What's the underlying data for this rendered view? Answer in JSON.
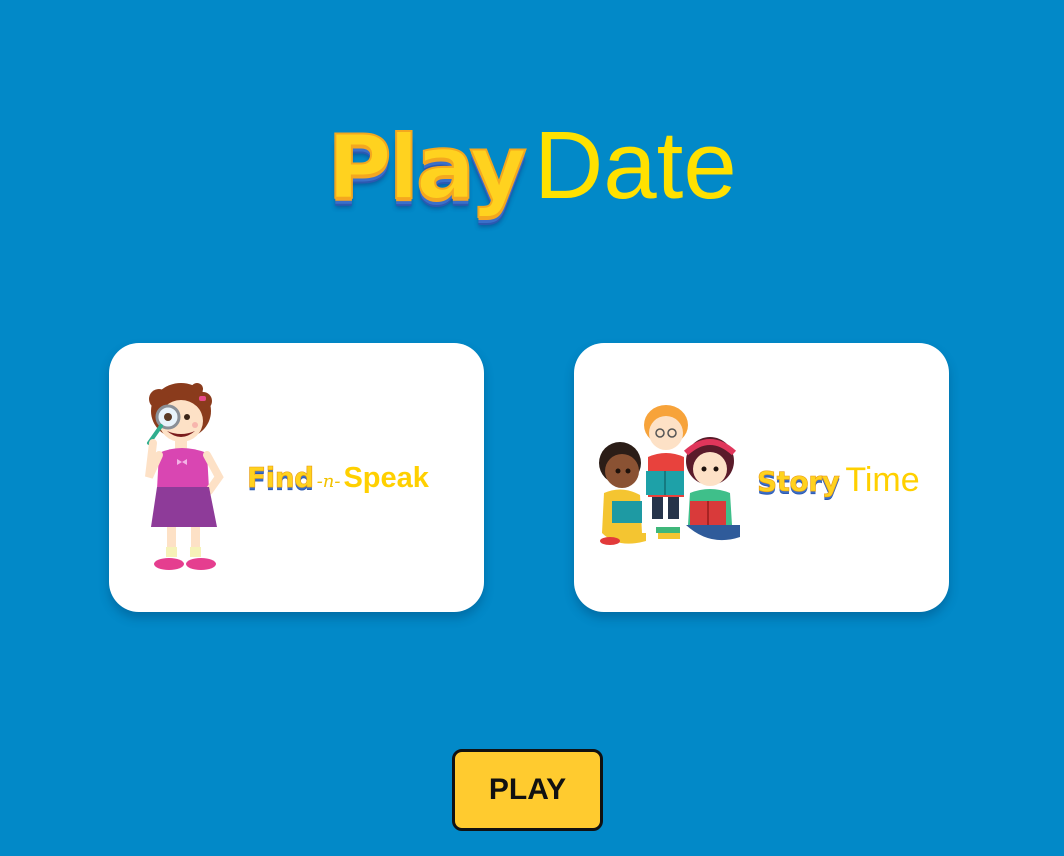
{
  "app": {
    "logo_part1": "Play",
    "logo_part2": "Date"
  },
  "games": [
    {
      "title_part1": "Find",
      "title_part2": "-n-",
      "title_part3": "Speak",
      "illustration": "girl-with-magnifying-glass-icon"
    },
    {
      "title_part1": "Story",
      "title_part2": "",
      "title_part3": "Time",
      "illustration": "kids-reading-books-icon"
    }
  ],
  "play_button": {
    "label": "PLAY"
  },
  "colors": {
    "background": "#0289c8",
    "accent_yellow": "#ffd21f",
    "button": "#ffcb2f"
  }
}
